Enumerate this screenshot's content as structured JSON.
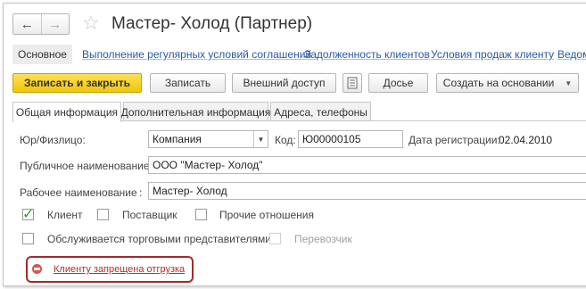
{
  "nav": {
    "back_glyph": "←",
    "forward_glyph": "→",
    "favorite_icon": "star-icon"
  },
  "title": "Мастер- Холод (Партнер)",
  "links": [
    "Основное",
    "Выполнение регулярных условий соглашений",
    "Задолженность клиентов",
    "Условия продаж клиенту",
    "Ведом"
  ],
  "buttons": {
    "save_close": "Записать и закрыть",
    "save": "Записать",
    "external_access": "Внешний доступ",
    "dossier": "Досье",
    "create_based_on": "Создать на основании"
  },
  "tabs": [
    "Общая информация",
    "Дополнительная информация",
    "Адреса, телефоны"
  ],
  "form": {
    "entity_type_label": "Юр/Физлицо:",
    "entity_type_value": "Компания",
    "code_label": "Код:",
    "code_value": "Ю00000105",
    "reg_date_label": "Дата регистрации:",
    "reg_date_value": "02.04.2010",
    "public_name_label": "Публичное наименование:",
    "public_name_value": "ООО \"Мастер- Холод\"",
    "working_name_label": "Рабочее наименование",
    "working_name_colon": ":",
    "working_name_value": "Мастер- Холод"
  },
  "checkboxes": {
    "client": {
      "label": "Клиент",
      "checked": true
    },
    "supplier": {
      "label": "Поставщик",
      "checked": false
    },
    "other": {
      "label": "Прочие отношения",
      "checked": false
    },
    "sales_reps": {
      "label": "Обслуживается торговыми представителями",
      "checked": false
    },
    "carrier": {
      "label": "Перевозчик",
      "checked": false,
      "disabled": true
    }
  },
  "warning": {
    "text": "Клиенту запрещена отгрузка",
    "color": "#a42a2a"
  },
  "colors": {
    "primary_button": "#f2c50a",
    "link": "#2759a8"
  }
}
